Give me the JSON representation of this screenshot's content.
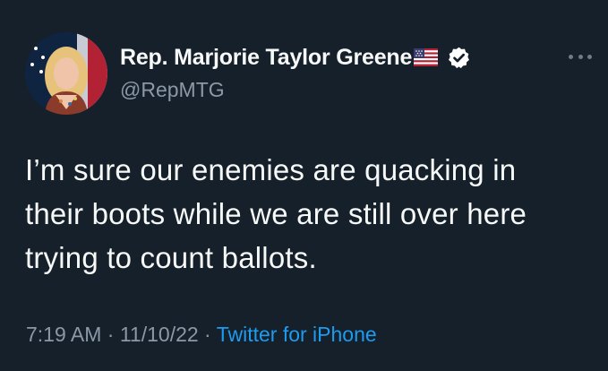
{
  "tweet": {
    "author": {
      "display_name": "Rep. Marjorie Taylor Greene",
      "name_emoji": "us-flag-emoji",
      "verified_icon": "verified-badge-icon",
      "handle": "@RepMTG",
      "avatar": "profile-photo"
    },
    "more_icon": "more-options-icon",
    "text_lines": [
      "I’m sure our enemies are quacking in",
      "their boots while we are still over here",
      "trying to count ballots."
    ],
    "meta": {
      "time": "7:19 AM",
      "separator": " · ",
      "date": "11/10/22",
      "source": "Twitter for iPhone"
    }
  },
  "colors": {
    "background": "#15202b",
    "primary_text": "#f7f9f9",
    "secondary_text": "#8b98a5",
    "link": "#1d9bf0"
  }
}
